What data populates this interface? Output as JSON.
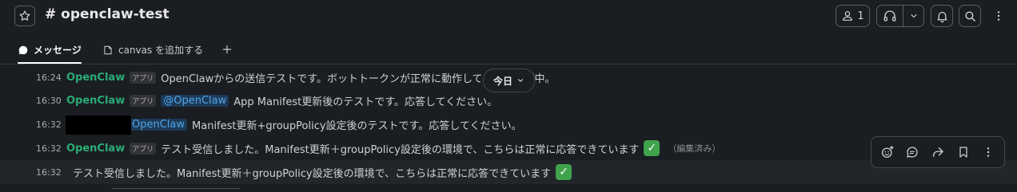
{
  "header": {
    "channel_name": "# openclaw-test",
    "member_count": "1"
  },
  "tabs": {
    "messages_label": "メッセージ",
    "canvas_label": "canvas を追加する"
  },
  "date_divider": {
    "label": "今日"
  },
  "messages": [
    {
      "time": "16:24",
      "author": "OpenClaw",
      "badge": "アプリ",
      "text": "OpenClawからの送信テストです。ボットトークンが正常に動作しているか確認中。"
    },
    {
      "time": "16:30",
      "author": "OpenClaw",
      "badge": "アプリ",
      "mention": "@OpenClaw",
      "text": "App Manifest更新後のテストです。応答してください。"
    },
    {
      "time": "16:32",
      "mention": "@OpenClaw",
      "text": "Manifest更新+groupPolicy設定後のテストです。応答してください。"
    },
    {
      "time": "16:32",
      "author": "OpenClaw",
      "badge": "アプリ",
      "text": "テスト受信しました。Manifest更新＋groupPolicy設定後の環境で、こちらは正常に応答できています",
      "edited": "（編集済み）"
    },
    {
      "time": "16:32",
      "text": "テスト受信しました。Manifest更新＋groupPolicy設定後の環境で、こちらは正常に応答できています"
    }
  ],
  "colors": {
    "background": "#1a1d21",
    "author_green": "#2bac76",
    "mention_blue": "#4fa4e8",
    "check_green": "#3fa34d"
  },
  "icons": [
    "star-icon",
    "person-icon",
    "headphones-icon",
    "chevron-down-icon",
    "bell-icon",
    "search-icon",
    "more-vertical-icon",
    "message-bubble-icon",
    "canvas-icon",
    "plus-icon",
    "add-reaction-icon",
    "reply-thread-icon",
    "share-icon",
    "bookmark-icon"
  ]
}
